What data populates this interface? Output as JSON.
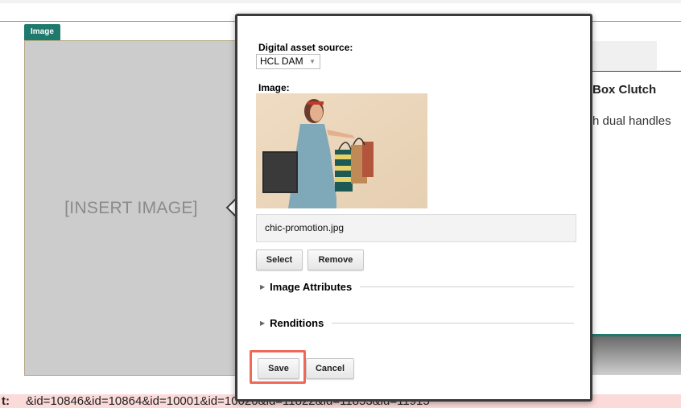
{
  "page": {
    "image_tag": "Image",
    "insert_image": "[INSERT IMAGE]",
    "product_title": "Box Clutch",
    "product_desc": "h dual handles",
    "ids_label": "t:",
    "ids_text": "&id=10846&id=10864&id=10001&id=10020&id=11822&id=11853&id=11915"
  },
  "dialog": {
    "source_label": "Digital asset source:",
    "source_value": "HCL DAM",
    "image_label": "Image:",
    "image_alt": "Woman holding shopping bags",
    "filename": "chic-promotion.jpg",
    "select_label": "Select",
    "remove_label": "Remove",
    "sections": [
      {
        "title": "Image Attributes"
      },
      {
        "title": "Renditions"
      }
    ],
    "save_label": "Save",
    "cancel_label": "Cancel"
  },
  "colors": {
    "teal": "#1f7a6e",
    "accent_orange": "#e8704a",
    "save_highlight": "#ee6a57"
  },
  "icons": {
    "dropdown": "chevron-down-icon",
    "section_toggle": "triangle-right-icon"
  }
}
